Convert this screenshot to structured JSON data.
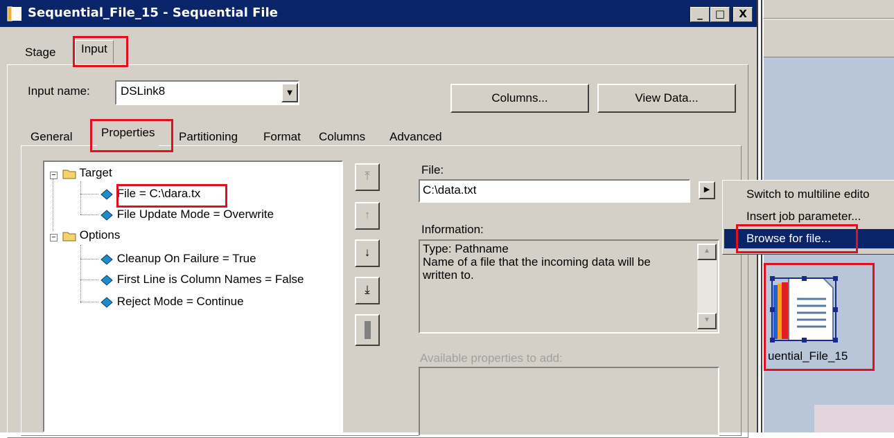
{
  "window": {
    "title": "Sequential_File_15 - Sequential File",
    "min_label": "_",
    "max_label": "□",
    "close_label": "X"
  },
  "outer_tabs": [
    "Stage",
    "Input"
  ],
  "input_name": {
    "label": "Input name:",
    "value": "DSLink8"
  },
  "buttons": {
    "columns": "Columns...",
    "view_data": "View Data..."
  },
  "inner_tabs": [
    "General",
    "Properties",
    "Partitioning",
    "Format",
    "Columns",
    "Advanced"
  ],
  "tree": {
    "target": "Target",
    "file": "File = C:\\dara.tx",
    "file_update_mode": "File Update Mode = Overwrite",
    "options": "Options",
    "cleanup": "Cleanup On Failure = True",
    "first_line": "First Line is Column Names = False",
    "reject": "Reject Mode = Continue"
  },
  "file": {
    "label": "File:",
    "value": "C:\\data.txt"
  },
  "information": {
    "label": "Information:",
    "text_line1": "Type: Pathname",
    "text_line2": "Name of a file that the incoming data will be",
    "text_line3": "written to."
  },
  "available": {
    "label": "Available properties to add:"
  },
  "context_menu": [
    "Switch to multiline edito",
    "Insert job parameter...",
    "Browse for file..."
  ],
  "stage_label": "uential_File_15",
  "colors": {
    "title_bar": "#0a246a",
    "dialog_bg": "#d4d0c8",
    "highlight_box": "#e01020",
    "canvas_bg": "#b9c6d9"
  }
}
